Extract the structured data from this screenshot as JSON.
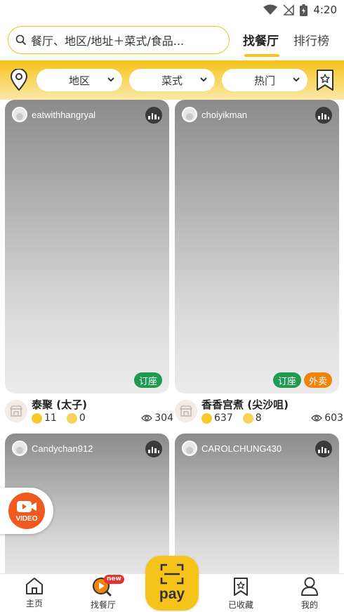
{
  "status_bar": {
    "time": "4:20"
  },
  "header": {
    "search_placeholder": "餐厅、地区/地址＋菜式/食品...",
    "tabs": [
      {
        "label": "找餐厅",
        "active": true
      },
      {
        "label": "排行榜",
        "active": false
      }
    ]
  },
  "filters": [
    {
      "label": "地区"
    },
    {
      "label": "菜式"
    },
    {
      "label": "热门"
    }
  ],
  "cards": [
    {
      "username": "eatwithhangryal",
      "badges": [
        "订座"
      ],
      "shop_name": "泰聚 (太子)",
      "likes": "11",
      "dislikes": "0",
      "views": "304"
    },
    {
      "username": "choiyikman",
      "badges": [
        "订座",
        "外卖"
      ],
      "shop_name": "香香宫煮 (尖沙咀)",
      "likes": "637",
      "dislikes": "8",
      "views": "603"
    },
    {
      "username": "Candychan912"
    },
    {
      "username": "CAROLCHUNG430"
    }
  ],
  "video_button": {
    "label": "VIDEO"
  },
  "bottom_nav": {
    "home": "主页",
    "find": "找餐厅",
    "new_badge": "new",
    "pay": "pay",
    "saved": "已收藏",
    "me": "我的"
  },
  "colors": {
    "accent": "#f6c31a",
    "reserve_badge": "#1f9a4f",
    "takeaway_badge": "#f0830e",
    "video": "#f05a1f"
  }
}
